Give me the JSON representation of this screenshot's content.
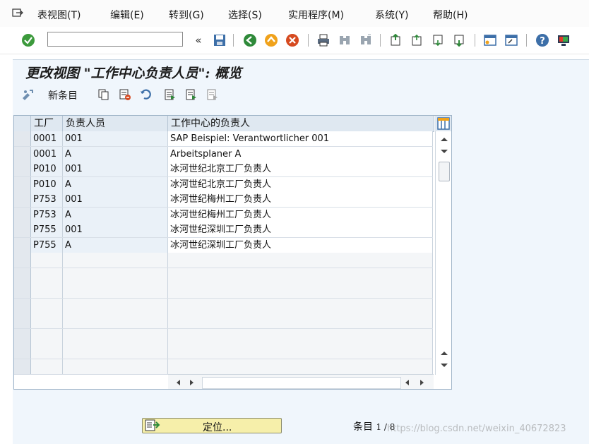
{
  "menu": {
    "items": [
      "表视图(T)",
      "编辑(E)",
      "转到(G)",
      "选择(S)",
      "实用程序(M)",
      "系统(Y)",
      "帮助(H)"
    ]
  },
  "toolbar": {
    "command_field_value": "",
    "icons": [
      "check-icon",
      "back-double-icon",
      "save-icon",
      "back-icon",
      "exit-icon",
      "cancel-icon",
      "print-icon",
      "find-icon",
      "find-next-icon",
      "first-page-icon",
      "prev-page-icon",
      "next-page-icon",
      "last-page-icon",
      "new-session-icon",
      "shortcut-icon",
      "help-icon",
      "customize-icon"
    ]
  },
  "title": "更改视图 \"工作中心负责人员\": 概览",
  "app_toolbar": {
    "new_entries_label": "新条目"
  },
  "table": {
    "columns": [
      "工厂",
      "负责人员",
      "工作中心的负责人"
    ],
    "rows": [
      [
        "0001",
        "001",
        "SAP Beispiel: Verantwortlicher 001"
      ],
      [
        "0001",
        "A",
        "Arbeitsplaner A"
      ],
      [
        "P010",
        "001",
        "冰河世纪北京工厂负责人"
      ],
      [
        "P010",
        "A",
        "冰河世纪北京工厂负责人"
      ],
      [
        "P753",
        "001",
        "冰河世纪梅州工厂负责人"
      ],
      [
        "P753",
        "A",
        "冰河世纪梅州工厂负责人"
      ],
      [
        "P755",
        "001",
        "冰河世纪深圳工厂负责人"
      ],
      [
        "P755",
        "A",
        "冰河世纪深圳工厂负责人"
      ]
    ]
  },
  "footer": {
    "locate_button": "定位...",
    "entry_label": "条目",
    "entry_count": "1 / 8",
    "watermark": "https://blog.csdn.net/weixin_40672823"
  },
  "colors": {
    "title_bg": "#f0f6fc",
    "locate_button_bg": "#f6efaa",
    "key_column_bg": "#eaf1f8"
  }
}
